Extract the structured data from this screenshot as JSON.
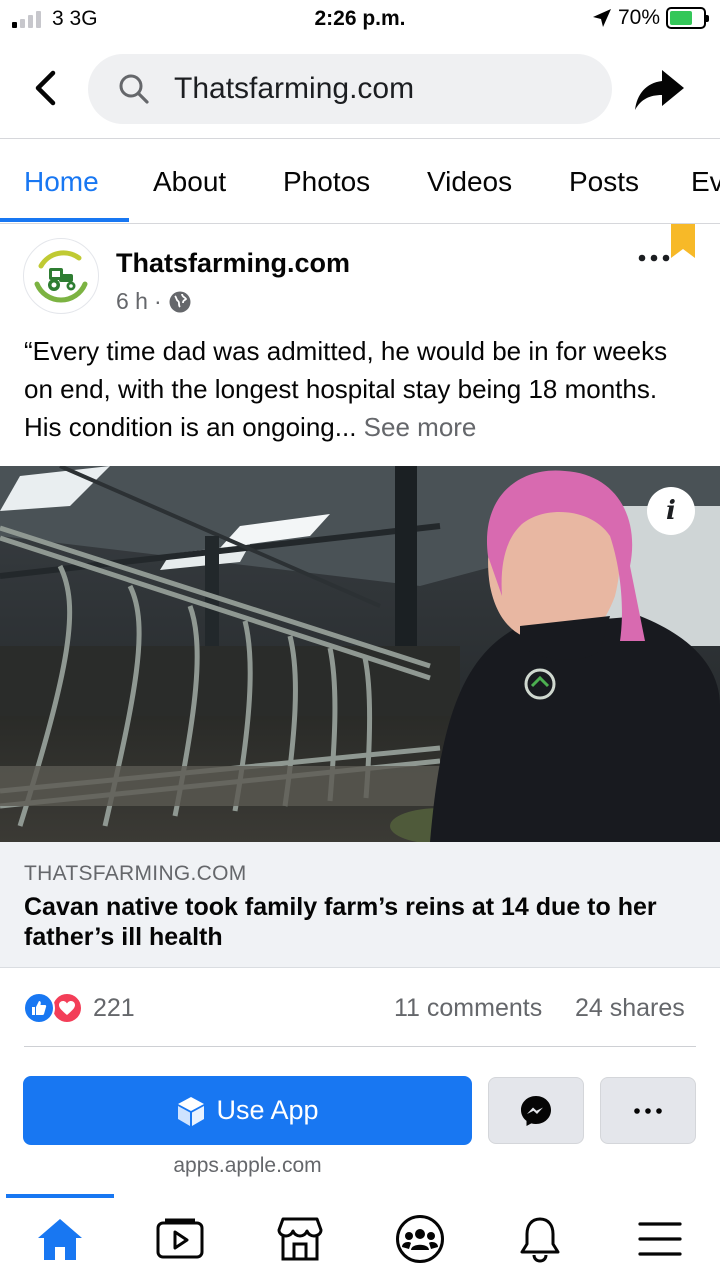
{
  "status_bar": {
    "carrier": "3  3G",
    "time": "2:26 p.m.",
    "battery": "70%",
    "signal_bars": 1,
    "battery_level": 0.7
  },
  "search": {
    "value": "Thatsfarming.com",
    "icon": "search-icon"
  },
  "tabs": [
    {
      "label": "Home",
      "active": true
    },
    {
      "label": "About"
    },
    {
      "label": "Photos"
    },
    {
      "label": "Videos"
    },
    {
      "label": "Posts"
    },
    {
      "label": "Ev"
    }
  ],
  "post": {
    "author": "Thatsfarming.com",
    "time": "6 h",
    "separator": "·",
    "text": "“Every time dad was admitted, he would be in for weeks on end, with the longest hospital stay being 18 months. His condition is an ongoing...",
    "see_more": "See more",
    "info_icon": "i",
    "link": {
      "domain": "THATSFARMING.COM",
      "title": "Cavan native took family farm’s reins at 14 due to her father’s ill health"
    },
    "reactions": {
      "count": "221",
      "comments": "11 comments",
      "shares": "24 shares"
    }
  },
  "actions": {
    "use_app": "Use App",
    "app_domain": "apps.apple.com"
  },
  "bottom_nav": [
    "home-icon",
    "watch-icon",
    "marketplace-icon",
    "groups-icon",
    "notifications-icon",
    "menu-icon"
  ],
  "colors": {
    "accent": "#1877f2",
    "love": "#f33e58",
    "bookmark": "#f7b928",
    "secondary_text": "#65676b"
  }
}
